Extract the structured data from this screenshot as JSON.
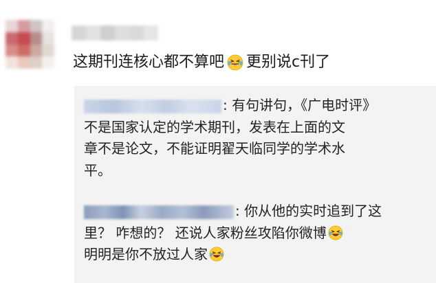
{
  "comment": {
    "text_before_emoji": "这期刊连核心都不算吧",
    "emoji": "laugh-cry-icon",
    "text_after_emoji": "更别说c刊了"
  },
  "replies": [
    {
      "separator": ": ",
      "line1": "有句讲句，《广电时评》",
      "line2": "不是国家认定的学术期刊，发表在上面的文",
      "line3": "章不是论文，不能证明翟天临同学的学术水",
      "line4": "平。"
    },
    {
      "separator": ": ",
      "line1": "你从他的实时追到了这",
      "line2": "里？ 咋想的？ 还说人家粉丝攻陷你微博",
      "line3": "明明是你不放过人家"
    }
  ],
  "colors": {
    "reply_background": "#f3f3f3",
    "text": "#222222"
  }
}
